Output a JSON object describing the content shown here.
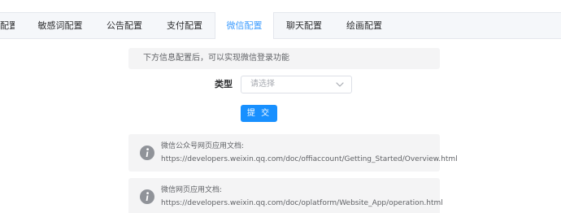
{
  "tabs": [
    {
      "label": "配置",
      "active": false
    },
    {
      "label": "敏感词配置",
      "active": false
    },
    {
      "label": "公告配置",
      "active": false
    },
    {
      "label": "支付配置",
      "active": false
    },
    {
      "label": "微信配置",
      "active": true
    },
    {
      "label": "聊天配置",
      "active": false
    },
    {
      "label": "绘画配置",
      "active": false
    }
  ],
  "notice": {
    "text": "下方信息配置后，可以实现微信登录功能"
  },
  "form": {
    "type_label": "类型",
    "select_placeholder": "请选择",
    "submit_label": "提 交"
  },
  "docs": [
    {
      "title": "微信公众号网页应用文档:",
      "url": "https://developers.weixin.qq.com/doc/offiaccount/Getting_Started/Overview.html",
      "icon": "info-icon"
    },
    {
      "title": "微信网页应用文档:",
      "url": "https://developers.weixin.qq.com/doc/oplatform/Website_App/operation.html",
      "icon": "info-icon"
    }
  ],
  "colors": {
    "accent": "#409eff",
    "button": "#1890ff",
    "alert_bg": "#f4f4f5",
    "tabs_bg": "#f5f7fa"
  }
}
